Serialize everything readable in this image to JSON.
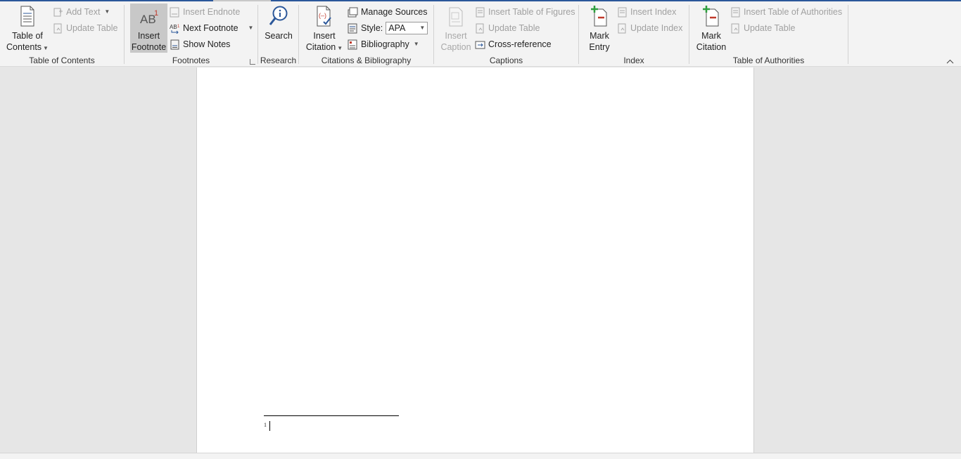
{
  "ribbon": {
    "toc": {
      "table_of_contents_label": "Table of",
      "table_of_contents_label2": "Contents",
      "add_text": "Add Text",
      "update_table": "Update Table",
      "group_label": "Table of Contents"
    },
    "footnotes": {
      "insert_footnote_label": "Insert",
      "insert_footnote_label2": "Footnote",
      "insert_endnote": "Insert Endnote",
      "next_footnote": "Next Footnote",
      "show_notes": "Show Notes",
      "group_label": "Footnotes"
    },
    "research": {
      "search_label": "Search",
      "group_label": "Research"
    },
    "citations": {
      "insert_citation_label": "Insert",
      "insert_citation_label2": "Citation",
      "manage_sources": "Manage Sources",
      "style_label": "Style:",
      "style_value": "APA",
      "bibliography": "Bibliography",
      "group_label": "Citations & Bibliography"
    },
    "captions": {
      "insert_caption_label": "Insert",
      "insert_caption_label2": "Caption",
      "insert_table_of_figures": "Insert Table of Figures",
      "update_table": "Update Table",
      "cross_reference": "Cross-reference",
      "group_label": "Captions"
    },
    "index": {
      "mark_entry_label": "Mark",
      "mark_entry_label2": "Entry",
      "insert_index": "Insert Index",
      "update_index": "Update Index",
      "group_label": "Index"
    },
    "authorities": {
      "mark_citation_label": "Mark",
      "mark_citation_label2": "Citation",
      "insert_table_of_authorities": "Insert Table of Authorities",
      "update_table": "Update Table",
      "group_label": "Table of Authorities"
    }
  },
  "document": {
    "footnote_ref": "1"
  },
  "colors": {
    "accent": "#2b579a",
    "footnote_red": "#c0392b",
    "index_green": "#2e9e3e"
  }
}
